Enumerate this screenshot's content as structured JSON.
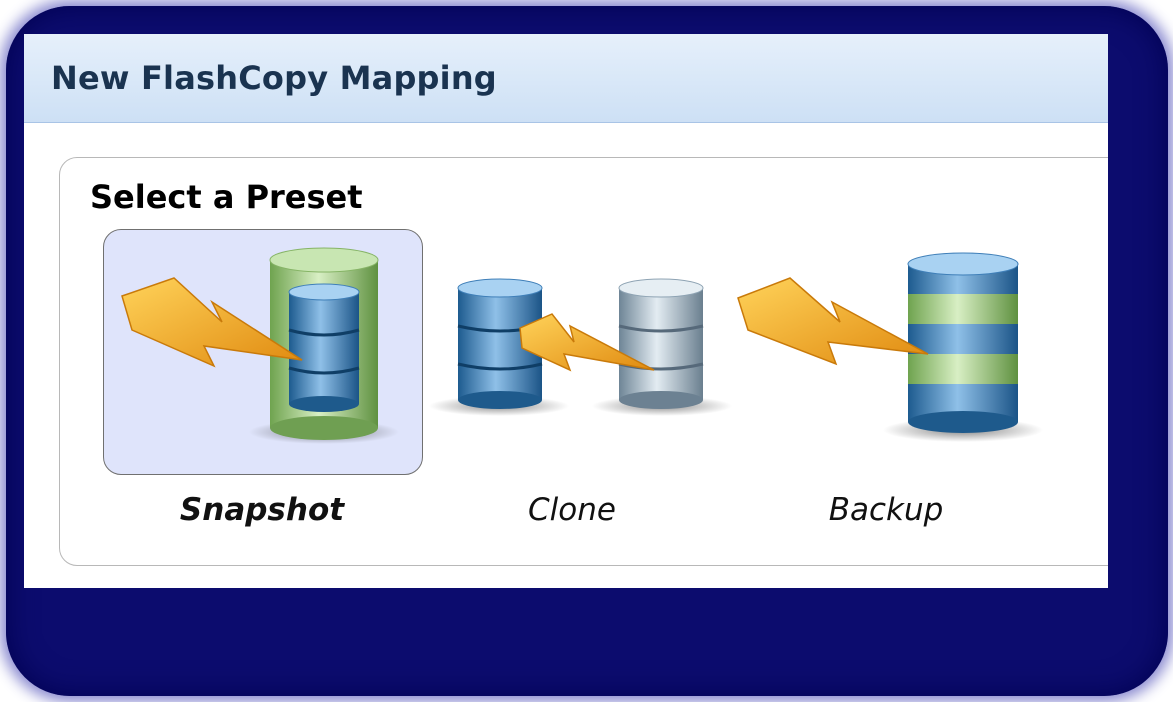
{
  "dialog": {
    "title": "New FlashCopy Mapping"
  },
  "presets_group": {
    "label": "Select a Preset",
    "presets": [
      {
        "label": "Snapshot",
        "icon": "snapshot-icon",
        "selected": true
      },
      {
        "label": "Clone",
        "icon": "clone-icon",
        "selected": false
      },
      {
        "label": "Backup",
        "icon": "backup-icon",
        "selected": false
      }
    ]
  },
  "colors": {
    "frame": "#0c0c6e",
    "titlebar": "#cde0f5",
    "selection": "#dfe4fb",
    "bolt": "#f2a51c",
    "db_blue": "#3f7fb8",
    "db_green": "#9ccc7e",
    "db_gray": "#a7b9c6"
  }
}
